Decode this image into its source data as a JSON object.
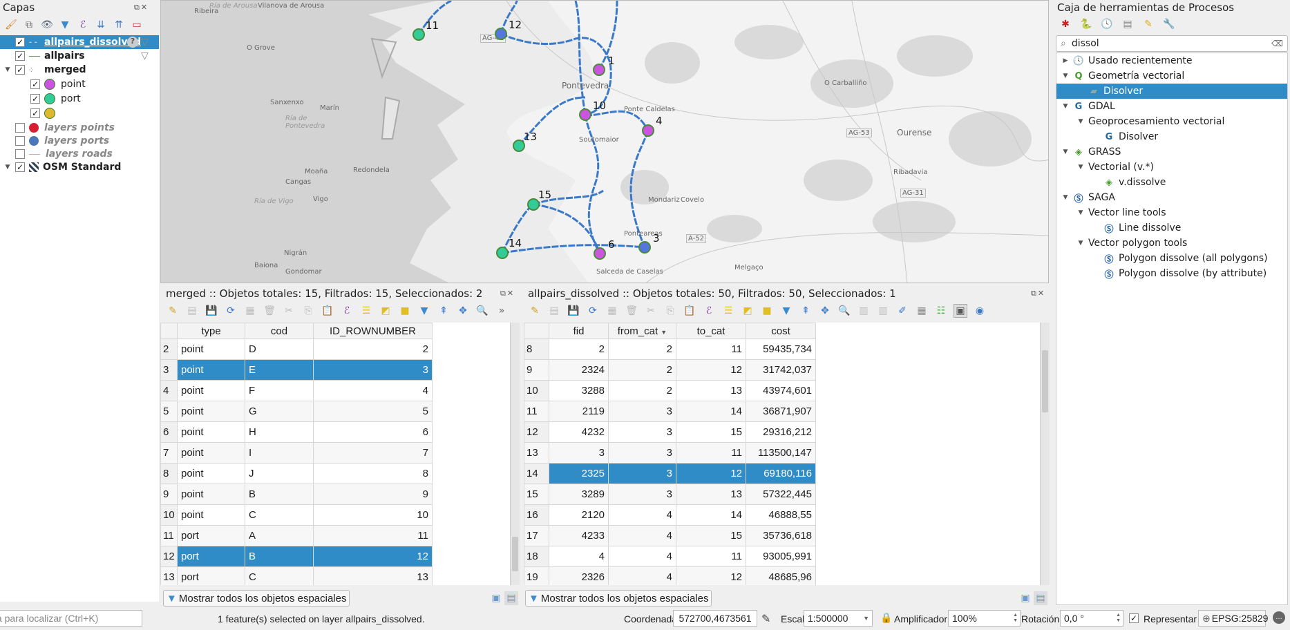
{
  "layers_panel": {
    "title": "Capas",
    "items": [
      {
        "label": "allpairs_dissolved",
        "checked": true,
        "selected": true,
        "symbol": "dashed-line"
      },
      {
        "label": "allpairs",
        "checked": true,
        "symbol": "line",
        "color": "#6a9a5a"
      },
      {
        "label": "merged",
        "checked": true,
        "expanded": true,
        "symbol": "points"
      },
      {
        "label": "point",
        "checked": true,
        "color": "#cc55e0"
      },
      {
        "label": "port",
        "checked": true,
        "color": "#33cc99"
      },
      {
        "label": "",
        "checked": true,
        "color": "#e0b830"
      },
      {
        "label": "layers points",
        "checked": false,
        "color": "#d42030"
      },
      {
        "label": "layers ports",
        "checked": false,
        "color": "#4a78b8"
      },
      {
        "label": "layers roads",
        "checked": false,
        "symbol": "line",
        "color": "#e8a0b0"
      },
      {
        "label": "OSM Standard",
        "checked": true,
        "expanded": true,
        "symbol": "raster"
      }
    ]
  },
  "map": {
    "markers": [
      {
        "label": "11",
        "type": "port",
        "color": "#33cc99"
      },
      {
        "label": "12",
        "type": "layer-port",
        "color": "#5577dd"
      },
      {
        "label": "1",
        "type": "point",
        "color": "#cc55e0"
      },
      {
        "label": "10",
        "type": "point",
        "color": "#cc55e0"
      },
      {
        "label": "4",
        "type": "point",
        "color": "#cc55e0"
      },
      {
        "label": "13",
        "type": "port",
        "color": "#33cc99"
      },
      {
        "label": "15",
        "type": "port",
        "color": "#33cc99"
      },
      {
        "label": "14",
        "type": "port",
        "color": "#33cc99"
      },
      {
        "label": "6",
        "type": "point",
        "color": "#cc55e0"
      },
      {
        "label": "3",
        "type": "layer-port",
        "color": "#5577dd"
      }
    ],
    "places": [
      "Ribeira",
      "Vilanova de Arousa",
      "O Grove",
      "Pontevedra",
      "Sanxenxo",
      "Marín",
      "Ponte Caldelas",
      "Soutomaior",
      "Moaña",
      "Cangas",
      "Redondela",
      "Vigo",
      "Nigrán",
      "Baiona",
      "Gondomar",
      "Salceda de Caselas",
      "Ponteareas",
      "Mondariz",
      "Covelo",
      "Ourense",
      "Ribadavia",
      "O Carballiño",
      "Melgaço",
      "AG-41",
      "AG-53",
      "AG-31",
      "A-52",
      "Ría de Arousa",
      "Ría de Pontevedra",
      "Ría de Vigo"
    ],
    "route_color": "#3a78c8"
  },
  "table_left": {
    "title": "merged :: Objetos totales: 15, Filtrados: 15, Seleccionados: 2",
    "columns": [
      "type",
      "cod",
      "ID_ROWNUMBER"
    ],
    "rows": [
      {
        "n": "2",
        "type": "point",
        "cod": "D",
        "id": "2",
        "selected": false
      },
      {
        "n": "3",
        "type": "point",
        "cod": "E",
        "id": "3",
        "selected": true
      },
      {
        "n": "4",
        "type": "point",
        "cod": "F",
        "id": "4",
        "selected": false
      },
      {
        "n": "5",
        "type": "point",
        "cod": "G",
        "id": "5",
        "selected": false
      },
      {
        "n": "6",
        "type": "point",
        "cod": "H",
        "id": "6",
        "selected": false
      },
      {
        "n": "7",
        "type": "point",
        "cod": "I",
        "id": "7",
        "selected": false
      },
      {
        "n": "8",
        "type": "point",
        "cod": "J",
        "id": "8",
        "selected": false
      },
      {
        "n": "9",
        "type": "point",
        "cod": "B",
        "id": "9",
        "selected": false
      },
      {
        "n": "10",
        "type": "point",
        "cod": "C",
        "id": "10",
        "selected": false
      },
      {
        "n": "11",
        "type": "port",
        "cod": "A",
        "id": "11",
        "selected": false
      },
      {
        "n": "12",
        "type": "port",
        "cod": "B",
        "id": "12",
        "selected": true
      },
      {
        "n": "13",
        "type": "port",
        "cod": "C",
        "id": "13",
        "selected": false
      }
    ],
    "filter_label": "Mostrar todos los objetos espaciales"
  },
  "table_right": {
    "title": "allpairs_dissolved :: Objetos totales: 50, Filtrados: 50, Seleccionados: 1",
    "columns": [
      "fid",
      "from_cat",
      "to_cat",
      "cost"
    ],
    "sort_column": "from_cat",
    "rows": [
      {
        "n": "8",
        "fid": "2",
        "from": "2",
        "to": "11",
        "cost": "59435,734",
        "selected": false
      },
      {
        "n": "9",
        "fid": "2324",
        "from": "2",
        "to": "12",
        "cost": "31742,037",
        "selected": false
      },
      {
        "n": "10",
        "fid": "3288",
        "from": "2",
        "to": "13",
        "cost": "43974,601",
        "selected": false
      },
      {
        "n": "11",
        "fid": "2119",
        "from": "3",
        "to": "14",
        "cost": "36871,907",
        "selected": false
      },
      {
        "n": "12",
        "fid": "4232",
        "from": "3",
        "to": "15",
        "cost": "29316,212",
        "selected": false
      },
      {
        "n": "13",
        "fid": "3",
        "from": "3",
        "to": "11",
        "cost": "113500,147",
        "selected": false
      },
      {
        "n": "14",
        "fid": "2325",
        "from": "3",
        "to": "12",
        "cost": "69180,116",
        "selected": true
      },
      {
        "n": "15",
        "fid": "3289",
        "from": "3",
        "to": "13",
        "cost": "57322,445",
        "selected": false
      },
      {
        "n": "16",
        "fid": "2120",
        "from": "4",
        "to": "14",
        "cost": "46888,55",
        "selected": false
      },
      {
        "n": "17",
        "fid": "4233",
        "from": "4",
        "to": "15",
        "cost": "35736,618",
        "selected": false
      },
      {
        "n": "18",
        "fid": "4",
        "from": "4",
        "to": "11",
        "cost": "93005,991",
        "selected": false
      },
      {
        "n": "19",
        "fid": "2326",
        "from": "4",
        "to": "12",
        "cost": "48685,96",
        "selected": false
      }
    ],
    "filter_label": "Mostrar todos los objetos espaciales"
  },
  "processing": {
    "title": "Caja de herramientas de Procesos",
    "search_value": "dissol",
    "tree": [
      {
        "label": "Usado recientemente",
        "level": 0,
        "icon": "clock-icon",
        "arrow": "right"
      },
      {
        "label": "Geometría vectorial",
        "level": 0,
        "icon": "qgis-icon",
        "arrow": "down"
      },
      {
        "label": "Disolver",
        "level": 1,
        "icon": "dissolve-icon",
        "selected": true
      },
      {
        "label": "GDAL",
        "level": 0,
        "icon": "gdal-icon",
        "arrow": "down"
      },
      {
        "label": "Geoprocesamiento vectorial",
        "level": 1,
        "arrow": "down"
      },
      {
        "label": "Disolver",
        "level": 2,
        "icon": "gdal-icon"
      },
      {
        "label": "GRASS",
        "level": 0,
        "icon": "grass-icon",
        "arrow": "down"
      },
      {
        "label": "Vectorial (v.*)",
        "level": 1,
        "arrow": "down"
      },
      {
        "label": "v.dissolve",
        "level": 2,
        "icon": "grass-icon"
      },
      {
        "label": "SAGA",
        "level": 0,
        "icon": "saga-icon",
        "arrow": "down"
      },
      {
        "label": "Vector line tools",
        "level": 1,
        "arrow": "down"
      },
      {
        "label": "Line dissolve",
        "level": 2,
        "icon": "saga-icon"
      },
      {
        "label": "Vector polygon tools",
        "level": 1,
        "arrow": "down"
      },
      {
        "label": "Polygon dissolve (all polygons)",
        "level": 2,
        "icon": "saga-icon"
      },
      {
        "label": "Polygon dissolve (by attribute)",
        "level": 2,
        "icon": "saga-icon"
      }
    ]
  },
  "statusbar": {
    "locator_placeholder": "Escriba para localizar (Ctrl+K)",
    "message": "1 feature(s) selected on layer allpairs_dissolved.",
    "coord_label": "Coordenada",
    "coord_value": "572700,4673561",
    "scale_label": "Escala",
    "scale_value": "1:500000",
    "magnifier_label": "Amplificador",
    "magnifier_value": "100%",
    "rotation_label": "Rotación",
    "rotation_value": "0,0 °",
    "render_label": "Representar",
    "render_checked": true,
    "crs": "EPSG:25829"
  },
  "colors": {
    "selection": "#308cc6",
    "panel": "#efefef"
  }
}
